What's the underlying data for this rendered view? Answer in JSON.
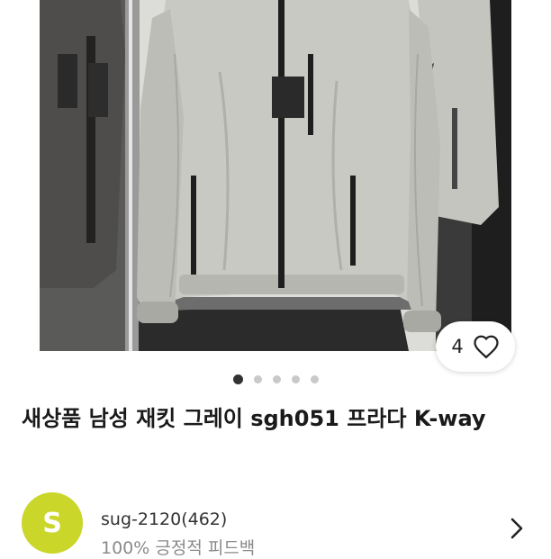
{
  "product": {
    "image_alt": "Gray men's jacket on store rack",
    "like_count": "4",
    "image_pages": 5,
    "current_page": 1,
    "title": "새상품 남성 재킷 그레이 sgh051 프라다 K-way"
  },
  "seller": {
    "avatar_letter": "S",
    "avatar_color": "#cbd62a",
    "name": "sug-2120(462)",
    "feedback": "100% 긍정적 피드백"
  },
  "icons": [
    "heart-icon",
    "chevron-right-icon"
  ]
}
